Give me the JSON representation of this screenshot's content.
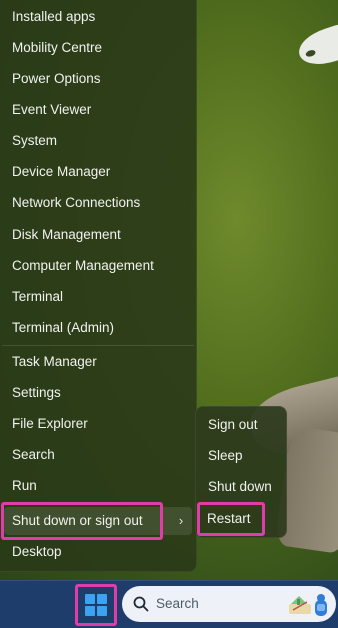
{
  "context_menu": {
    "items": [
      {
        "label": "Installed apps"
      },
      {
        "label": "Mobility Centre"
      },
      {
        "label": "Power Options"
      },
      {
        "label": "Event Viewer"
      },
      {
        "label": "System"
      },
      {
        "label": "Device Manager"
      },
      {
        "label": "Network Connections"
      },
      {
        "label": "Disk Management"
      },
      {
        "label": "Computer Management"
      },
      {
        "label": "Terminal"
      },
      {
        "label": "Terminal (Admin)"
      },
      {
        "label": "Task Manager"
      },
      {
        "label": "Settings"
      },
      {
        "label": "File Explorer"
      },
      {
        "label": "Search"
      },
      {
        "label": "Run"
      },
      {
        "label": "Shut down or sign out",
        "chevron": "›"
      },
      {
        "label": "Desktop"
      }
    ]
  },
  "submenu": {
    "items": [
      {
        "label": "Sign out"
      },
      {
        "label": "Sleep"
      },
      {
        "label": "Shut down"
      },
      {
        "label": "Restart"
      }
    ]
  },
  "taskbar": {
    "search_placeholder": "Search",
    "start_icon": "windows-logo-icon",
    "search_icon": "magnifier-icon"
  },
  "colors": {
    "highlight_outline": "#e03da9",
    "taskbar": "#1f3d6b",
    "windows_blue": "#3aa3f2"
  }
}
